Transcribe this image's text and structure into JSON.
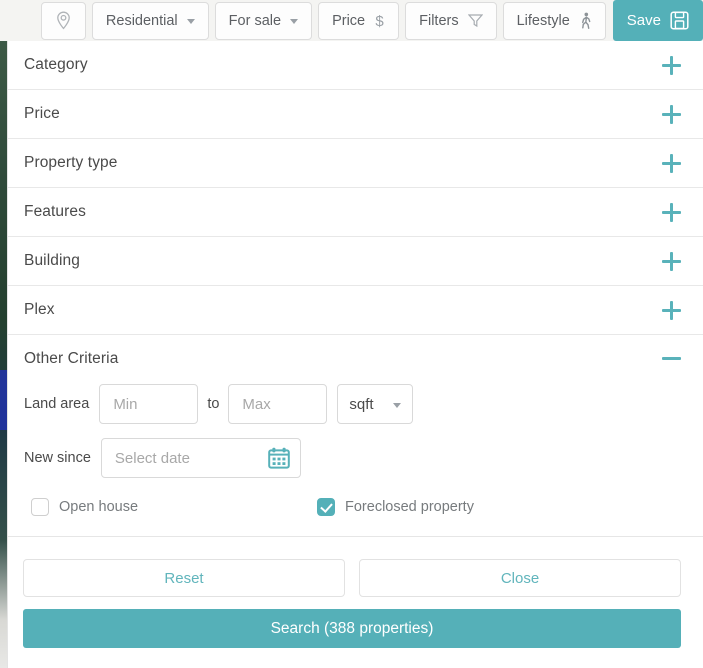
{
  "toolbar": {
    "location_icon": "map-pin-icon",
    "buttons": [
      {
        "label": "Residential",
        "icon": "chevron-down-icon"
      },
      {
        "label": "For sale",
        "icon": "chevron-down-icon"
      },
      {
        "label": "Price",
        "icon": "dollar-icon"
      },
      {
        "label": "Filters",
        "icon": "funnel-icon"
      },
      {
        "label": "Lifestyle",
        "icon": "walking-person-icon"
      }
    ],
    "save": {
      "label": "Save",
      "icon": "floppy-disk-icon"
    }
  },
  "accordion": {
    "sections": [
      {
        "label": "Category",
        "expanded": false,
        "toggle_icon": "plus-icon"
      },
      {
        "label": "Price",
        "expanded": false,
        "toggle_icon": "plus-icon"
      },
      {
        "label": "Property type",
        "expanded": false,
        "toggle_icon": "plus-icon"
      },
      {
        "label": "Features",
        "expanded": false,
        "toggle_icon": "plus-icon"
      },
      {
        "label": "Building",
        "expanded": false,
        "toggle_icon": "plus-icon"
      },
      {
        "label": "Plex",
        "expanded": false,
        "toggle_icon": "plus-icon"
      },
      {
        "label": "Other Criteria",
        "expanded": true,
        "toggle_icon": "minus-icon"
      }
    ]
  },
  "other_criteria": {
    "land_area": {
      "label": "Land area",
      "min_value": "",
      "min_placeholder": "Min",
      "separator": "to",
      "max_value": "",
      "max_placeholder": "Max",
      "unit_selected": "sqft",
      "unit_caret_icon": "chevron-down-icon"
    },
    "new_since": {
      "label": "New since",
      "value": "",
      "placeholder": "Select date",
      "icon": "calendar-icon"
    },
    "checkboxes": [
      {
        "label": "Open house",
        "checked": false
      },
      {
        "label": "Foreclosed property",
        "checked": true
      }
    ]
  },
  "footer": {
    "reset_label": "Reset",
    "close_label": "Close",
    "search_label": "Search (388 properties)"
  },
  "colors": {
    "accent": "#54b0b8",
    "accent_light": "#59b2ba",
    "text": "#4a4a4a",
    "muted": "#a8a8a8",
    "border": "#e2e2e2"
  }
}
